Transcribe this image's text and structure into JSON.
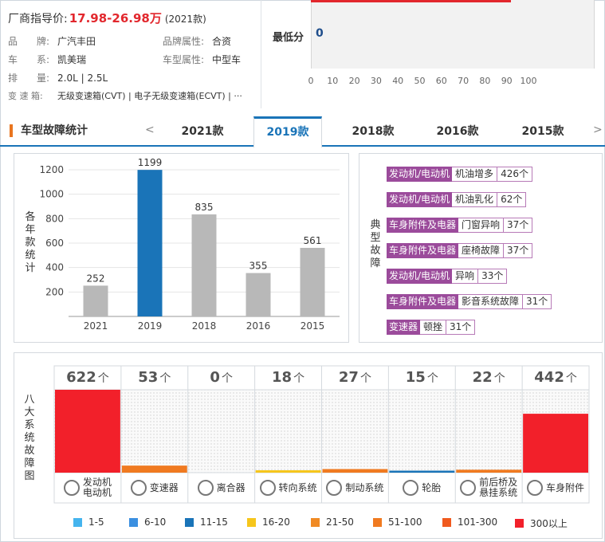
{
  "header": {
    "price_label": "厂商指导价:",
    "price_value": "17.98-26.98万",
    "price_year": "(2021款)",
    "fields": [
      {
        "k": "品　　牌:",
        "v": "广汽丰田"
      },
      {
        "k": "品牌属性:",
        "v": "合资"
      },
      {
        "k": "车　　系:",
        "v": "凯美瑞"
      },
      {
        "k": "车型属性:",
        "v": "中型车"
      },
      {
        "k": "排　　量:",
        "v": "2.0L | 2.5L"
      },
      {
        "k": "变 速 箱:",
        "v": "无级变速箱(CVT) | 电子无级变速箱(ECVT) | ···"
      }
    ]
  },
  "score": {
    "label": "最低分",
    "value": "0",
    "ticks": [
      "0",
      "10",
      "20",
      "30",
      "40",
      "50",
      "60",
      "70",
      "80",
      "90",
      "100"
    ],
    "bar_value": 90
  },
  "tabs": {
    "title": "车型故障统计",
    "prev": "<",
    "next": ">",
    "items": [
      "2021款",
      "2019款",
      "2018款",
      "2016款",
      "2015款"
    ],
    "active": 1
  },
  "year_chart": {
    "ylabel": "各年款统计",
    "chart_data": {
      "type": "bar",
      "categories": [
        "2021",
        "2019",
        "2018",
        "2016",
        "2015"
      ],
      "values": [
        252,
        1199,
        835,
        355,
        561
      ],
      "yticks": [
        200,
        400,
        600,
        800,
        1000,
        1200
      ],
      "ylim": [
        0,
        1200
      ],
      "highlight_index": 1,
      "colors": {
        "default": "#b8b8b8",
        "highlight": "#1a74b8"
      }
    }
  },
  "faults": {
    "label": "典型故障",
    "items": [
      {
        "cat": "发动机/电动机",
        "name": "机油增多",
        "count": "426个"
      },
      {
        "cat": "发动机/电动机",
        "name": "机油乳化",
        "count": "62个"
      },
      {
        "cat": "车身附件及电器",
        "name": "门窗异响",
        "count": "37个"
      },
      {
        "cat": "车身附件及电器",
        "name": "座椅故障",
        "count": "37个"
      },
      {
        "cat": "发动机/电动机",
        "name": "异响",
        "count": "33个"
      },
      {
        "cat": "车身附件及电器",
        "name": "影音系统故障",
        "count": "31个"
      },
      {
        "cat": "变速器",
        "name": "顿挫",
        "count": "31个"
      }
    ]
  },
  "systems": {
    "label": "八大系统故障图",
    "unit": "个",
    "items": [
      {
        "name": "发动机\n电动机",
        "count": "622",
        "value": 622,
        "color": "#f2202a",
        "icon": "engine-icon"
      },
      {
        "name": "变速器",
        "count": "53",
        "value": 53,
        "color": "#f07a20",
        "icon": "gear-shift-icon"
      },
      {
        "name": "离合器",
        "count": "0",
        "value": 0,
        "color": "#f07a20",
        "icon": "clutch-icon"
      },
      {
        "name": "转向系统",
        "count": "18",
        "value": 18,
        "color": "#f6c61c",
        "icon": "steering-wheel-icon"
      },
      {
        "name": "制动系统",
        "count": "27",
        "value": 27,
        "color": "#f07a20",
        "icon": "brake-disc-icon"
      },
      {
        "name": "轮胎",
        "count": "15",
        "value": 15,
        "color": "#1a74b8",
        "icon": "tire-icon"
      },
      {
        "name": "前后桥及\n悬挂系统",
        "count": "22",
        "value": 22,
        "color": "#f07a20",
        "icon": "suspension-icon"
      },
      {
        "name": "车身附件",
        "count": "442",
        "value": 442,
        "color": "#f2202a",
        "icon": "car-body-icon"
      }
    ],
    "legend": [
      {
        "label": "1-5",
        "color": "#45b4ee"
      },
      {
        "label": "6-10",
        "color": "#3b8fe0"
      },
      {
        "label": "11-15",
        "color": "#1a74b8"
      },
      {
        "label": "16-20",
        "color": "#f6c61c"
      },
      {
        "label": "21-50",
        "color": "#f08a24"
      },
      {
        "label": "51-100",
        "color": "#f07a20"
      },
      {
        "label": "101-300",
        "color": "#f05a1e"
      },
      {
        "label": "300以上",
        "color": "#f2202a"
      }
    ]
  }
}
